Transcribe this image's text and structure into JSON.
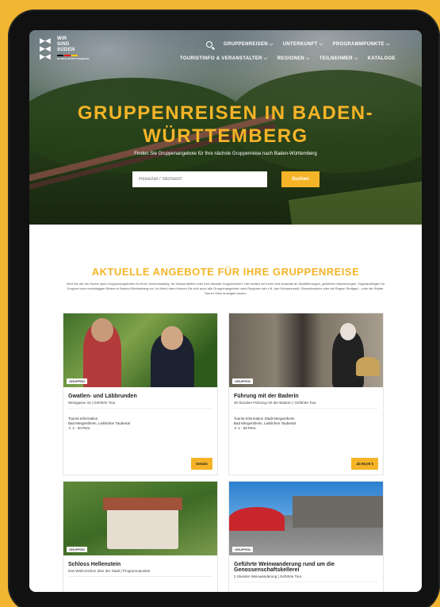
{
  "header": {
    "logo_lines": [
      "WIR",
      "SIND",
      "SÜDEN"
    ],
    "logo_tag": "BADEN-WÜRTTEMBERG",
    "nav_top": [
      "GRUPPENREISEN ⌵",
      "UNTERKUNFT ⌵",
      "PROGRAMMPUNKTE ⌵"
    ],
    "nav_bottom": [
      "TOURISTINFO & VERANSTALTER ⌵",
      "REGIONEN ⌵",
      "TEILNEHMER ⌵",
      "KATALOGE"
    ]
  },
  "hero": {
    "title_line1": "GRUPPENREISEN IN BADEN-",
    "title_line2": "WÜRTTEMBERG",
    "subtitle": "Finden Sie Gruppenangebote für Ihre nächste Gruppenreise nach Baden-Württemberg",
    "search_placeholder": "Reiseziel / Stichwort",
    "search_button": "Suchen"
  },
  "offers": {
    "heading": "AKTUELLE ANGEBOTE FÜR IHRE GRUPPENREISE",
    "intro": "Sind Sie auf der Suche nach Gruppenangeboten für Ihren Vereinsausflug, Ihr Klassentreffen oder Ihre nächste Gruppenreise? Hier stellen wir Ihnen eine Auswahl an Stadtführungen, geführten Wanderungen, Tagesausflügen für Gruppen oder mehrtägigen Reisen in Baden-Württemberg vor. Im Menü oben können Sie sich auch alle Gruppenangebote nach Regionen wie z.B. den Schwarzwald, Oberschwaben oder die Region Stuttgart – oder die Städte-Touren Sitze anzeigen lassen.",
    "cards": [
      {
        "badge": "GRUPPEN",
        "title": "Gwatlen- und Läbbrunden",
        "subtitle": "Weingasse 44 | Geführte Tour",
        "info1": "Tourist-Information",
        "info2": "Bad Mergentheim, Lieblichen Taubertal",
        "info3": "♙ 1 - 20 Pers.",
        "cta": "Details"
      },
      {
        "badge": "GRUPPEN",
        "title": "Führung mit der Baderin",
        "subtitle": "30 Stunden Führung mit der Baderin | Geführte Tour",
        "info1": "Tourist-Information Stadt Mergentheim",
        "info2": "Bad Mergentheim, Lieblichen Taubertal",
        "info3": "♙ 1 - 20 Pers.",
        "cta": "ab 60,00 €"
      },
      {
        "badge": "GRUPPEN",
        "title": "Schloss Hellenstein",
        "subtitle": "Das Wahrzeichen über der Stadt | Programmpunkte",
        "info1": "",
        "info2": "",
        "info3": "",
        "cta": ""
      },
      {
        "badge": "GRUPPEN",
        "title": "Geführte Weinwanderung rund um die Genossenschaftskellerei",
        "subtitle": "3 Stunden Weinwanderung | Geführte Tour",
        "info1": "",
        "info2": "",
        "info3": "",
        "cta": ""
      }
    ]
  }
}
